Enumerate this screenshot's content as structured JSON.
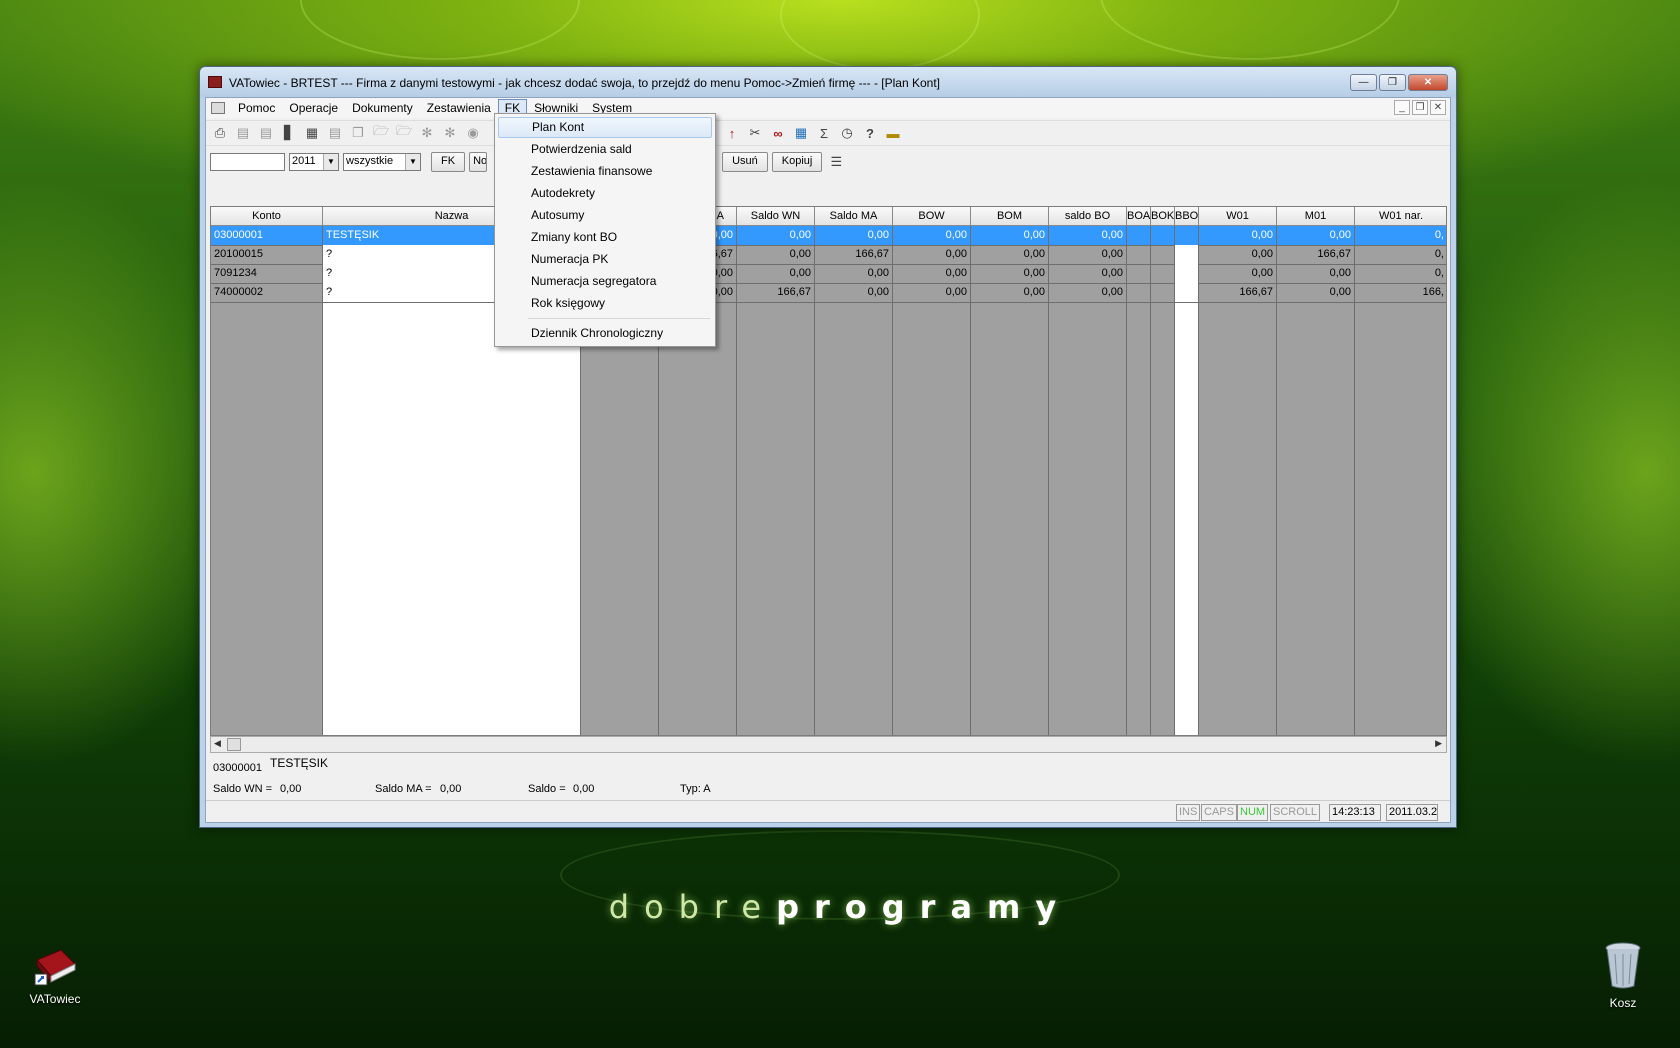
{
  "desktop": {
    "brand_light": "dobre",
    "brand_bold": "programy",
    "icons": [
      {
        "label": "VATowiec"
      },
      {
        "label": "Kosz"
      }
    ]
  },
  "window": {
    "title": "VATowiec - BRTEST    ---   Firma z danymi testowymi - jak chcesz dodać swoja, to przejdź do menu Pomoc->Zmień firmę   --- - [Plan Kont]"
  },
  "menu": [
    "Pomoc",
    "Operacje",
    "Dokumenty",
    "Zestawienia",
    "FK",
    "Słowniki",
    "System"
  ],
  "filter": {
    "search_value": "",
    "year": "2011",
    "scope": "wszystkie",
    "fk_label": "FK",
    "nowy_label": "Nowy",
    "usun_label": "Usuń",
    "kopiuj_label": "Kopiuj"
  },
  "grid": {
    "headers": {
      "konto": "Konto",
      "nazwa": "Nazwa",
      "obroty_ma": "Obroty MA",
      "saldo_wn": "Saldo WN",
      "saldo_ma": "Saldo MA",
      "bow": "BOW",
      "bom": "BOM",
      "saldo_bo": "saldo BO",
      "boa": "BOA",
      "bok": "BOK",
      "bbo": "BBO",
      "w01": "W01",
      "m01": "M01",
      "w01_nar": "W01 nar."
    },
    "rows": [
      {
        "konto": "03000001",
        "nazwa": "TESTĘSIK",
        "obroty_ma": "0,00",
        "saldo_wn": "0,00",
        "saldo_ma": "0,00",
        "bow": "0,00",
        "bom": "0,00",
        "saldo_bo": "0,00",
        "w01": "0,00",
        "m01": "0,00",
        "w01_nar": "0,"
      },
      {
        "konto": "20100015",
        "nazwa": "?",
        "obroty_ma": "166,67",
        "saldo_wn": "0,00",
        "saldo_ma": "166,67",
        "bow": "0,00",
        "bom": "0,00",
        "saldo_bo": "0,00",
        "w01": "0,00",
        "m01": "166,67",
        "w01_nar": "0,"
      },
      {
        "konto": "7091234",
        "nazwa": "?",
        "obroty_ma": "0,00",
        "saldo_wn": "0,00",
        "saldo_ma": "0,00",
        "bow": "0,00",
        "bom": "0,00",
        "saldo_bo": "0,00",
        "w01": "0,00",
        "m01": "0,00",
        "w01_nar": "0,"
      },
      {
        "konto": "74000002",
        "nazwa": "?",
        "obroty_ma": "0,00",
        "saldo_wn": "166,67",
        "saldo_ma": "0,00",
        "bow": "0,00",
        "bom": "0,00",
        "saldo_bo": "0,00",
        "w01": "166,67",
        "m01": "0,00",
        "w01_nar": "166,"
      }
    ]
  },
  "details": {
    "konto": "03000001",
    "nazwa": "TESTĘSIK",
    "saldo_wn_label": "Saldo WN =",
    "saldo_wn_value": "0,00",
    "saldo_ma_label": "Saldo MA =",
    "saldo_ma_value": "0,00",
    "saldo_label": "Saldo =",
    "saldo_value": "0,00",
    "typ": "Typ: A"
  },
  "status": {
    "ins": "INS",
    "caps": "CAPS",
    "num": "NUM",
    "scroll": "SCROLL",
    "time": "14:23:13",
    "date": "2011.03.2"
  },
  "fk_menu": {
    "items": [
      "Plan Kont",
      "Potwierdzenia sald",
      "Zestawienia finansowe",
      "Autodekrety",
      "Autosumy",
      "Zmiany kont BO",
      "Numeracja PK",
      "Numeracja segregatora",
      "Rok księgowy"
    ],
    "after_separator": "Dziennik Chronologiczny"
  },
  "colors": {
    "selection": "#3399ff",
    "grid_gray": "#a0a0a0",
    "num_active": "#3bc93b"
  }
}
